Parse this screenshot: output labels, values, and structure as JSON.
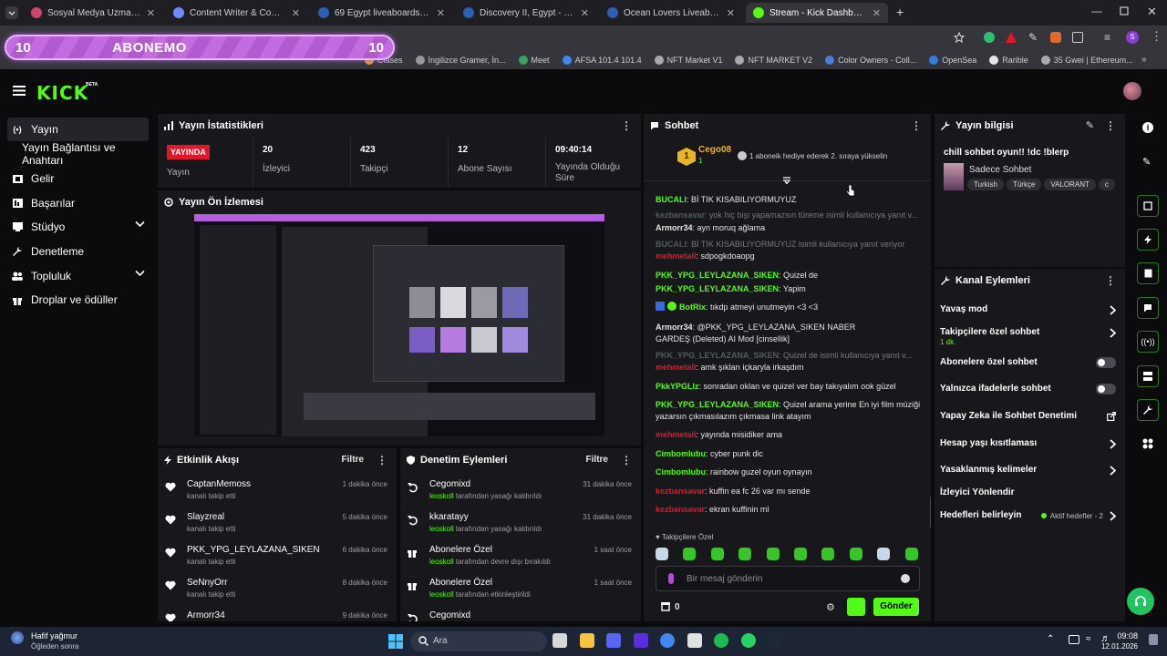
{
  "browser": {
    "tabs": [
      {
        "title": "Sosyal Medya Uzmanı Aranıyor",
        "color": "#d0446a"
      },
      {
        "title": "Content Writer & Community M...",
        "color": "#6b8cff"
      },
      {
        "title": "69 Egypt liveaboards, May 2026",
        "color": "#2b5fb3"
      },
      {
        "title": "Discovery II, Egypt - LiveAboa...",
        "color": "#2b5fb3"
      },
      {
        "title": "Ocean Lovers Liveaboard, Egypt",
        "color": "#2b5fb3"
      },
      {
        "title": "Stream - Kick Dashboard",
        "color": "#53fc18"
      }
    ],
    "new_tab": "+",
    "bookmarks": [
      "Clases",
      "İngilizce Gramer, İn...",
      "Meet",
      "AFSA 101.4 101.4",
      "NFT Market V1",
      "NFT MARKET V2",
      "Color Owners - Coll...",
      "OpenSea",
      "Rarible",
      "35 Gwei | Ethereum..."
    ]
  },
  "banner": {
    "left": "10",
    "title": "ABONEMO",
    "right": "10"
  },
  "kick": {
    "logo": "KICK",
    "beta": "BETA"
  },
  "sidebar": {
    "items": [
      {
        "label": "Yayın",
        "icon": "broadcast-icon"
      },
      {
        "label": "Yayın Bağlantısı ve Anahtarı",
        "icon": ""
      },
      {
        "label": "Gelir",
        "icon": "money-icon"
      },
      {
        "label": "Başarılar",
        "icon": "trophy-icon"
      },
      {
        "label": "Stüdyo",
        "icon": "studio-icon"
      },
      {
        "label": "Denetleme",
        "icon": "wrench-icon"
      },
      {
        "label": "Topluluk",
        "icon": "people-icon"
      },
      {
        "label": "Droplar ve ödüller",
        "icon": "gift-icon"
      }
    ]
  },
  "stats": {
    "title": "Yayın İstatistikleri",
    "live_badge": "YAYINDA",
    "items": [
      {
        "value": "",
        "label": "Yayın"
      },
      {
        "value": "20",
        "label": "İzleyici"
      },
      {
        "value": "423",
        "label": "Takipçi"
      },
      {
        "value": "12",
        "label": "Abone Sayısı"
      },
      {
        "value": "09:40:14",
        "label": "Yayında Olduğu Süre"
      }
    ]
  },
  "preview": {
    "title": "Yayın Ön İzlemesi"
  },
  "activity": {
    "title": "Etkinlik Akışı",
    "filter": "Filtre",
    "rows": [
      {
        "name": "CaptanMemoss",
        "sub": "kanalı takip etti",
        "time": "1 dakika önce"
      },
      {
        "name": "Slayzreal",
        "sub": "kanalı takip etti",
        "time": "5 dakika önce"
      },
      {
        "name": "PKK_YPG_LEYLAZANA_SIKEN",
        "sub": "kanalı takip etti",
        "time": "6 dakika önce"
      },
      {
        "name": "SeNnyOrr",
        "sub": "kanalı takip etti",
        "time": "8 dakika önce"
      },
      {
        "name": "Armorr34",
        "sub": "",
        "time": "9 dakika önce"
      }
    ]
  },
  "moderation": {
    "title": "Denetim Eylemleri",
    "filter": "Filtre",
    "rows": [
      {
        "name": "Cegomixd",
        "actor": "leoskoll",
        "sub": " tarafından yasağı kaldırıldı",
        "time": "31 dakika önce",
        "icon": "undo-icon"
      },
      {
        "name": "kkaratayy",
        "actor": "leoskoll",
        "sub": " tarafından yasağı kaldırıldı",
        "time": "31 dakika önce",
        "icon": "undo-icon"
      },
      {
        "name": "Abonelere Özel",
        "actor": "leoskoll",
        "sub": " tarafından devre dışı bırakıldı",
        "time": "1 saat önce",
        "icon": "gift-icon"
      },
      {
        "name": "Abonelere Özel",
        "actor": "leoskoll",
        "sub": " tarafından etkinleştirildi",
        "time": "1 saat önce",
        "icon": "gift-icon"
      },
      {
        "name": "Cegomixd",
        "actor": "",
        "sub": "",
        "time": "",
        "icon": "undo-icon"
      }
    ]
  },
  "chat": {
    "title": "Sohbet",
    "pinned_user": "Cego08",
    "pinned_rank": "1",
    "pinned_count": "1",
    "pinned_text": "1 aboneik hediye ederek 2. sıraya yükselin",
    "messages": [
      {
        "user": "BUCALI",
        "text": ": Bİ TIK KISABILIYORMUYUZ",
        "color": "#53fc18",
        "dim": false
      },
      {
        "user": "kezbansavar",
        "text": ": yok hiç bişi yapamazsın türeme isimli kullanıcıya yanıt v...",
        "color": "#9aa",
        "dim": true
      },
      {
        "user": "Armorr34",
        "text": ": ayn moruq ağlama",
        "color": "#e6e6e6",
        "dim": false
      },
      {
        "user": "BUCALI",
        "text": ": Bİ TIK KISABILIYORMUYUZ isimli kullanıcıya yanıt veriyor",
        "color": "#9aa",
        "dim": true
      },
      {
        "user": "mehmetali",
        "text": ": sdpogkdoaopg",
        "color": "#e0162b",
        "dim": false
      },
      {
        "user": "PKK_YPG_LEYLAZANA_SIKEN",
        "text": ": Quizel de",
        "color": "#53fc18",
        "dim": false
      },
      {
        "user": "PKK_YPG_LEYLAZANA_SIKEN",
        "text": ": Yapim",
        "color": "#53fc18",
        "dim": false
      },
      {
        "user": "BotRix",
        "text": ": tıkdp atmeyi unutmeyin <3 <3",
        "color": "#53fc18",
        "dim": false
      },
      {
        "user": "Armorr34",
        "text": ": @PKK_YPG_LEYLAZANA_SIKEN NABER",
        "color": "#e6e6e6",
        "dim": false
      },
      {
        "user": "",
        "text": "GARDEŞ (Deleted) AI Mod [cinsellik]",
        "color": "#e6e6e6",
        "dim": false
      },
      {
        "user": "PKK_YPG_LEYLAZANA_SIKEN",
        "text": ": Quizel de isimli kullanıcıya yanıt v...",
        "color": "#9aa",
        "dim": true
      },
      {
        "user": "mehmetali",
        "text": ": amk şıkları içkaryla irkaşdım",
        "color": "#e0162b",
        "dim": false
      },
      {
        "user": "PkkYPGLlz",
        "text": ": sonradan oklan ve quizel ver bay takıyalım ook güzel",
        "color": "#53fc18",
        "dim": false
      },
      {
        "user": "PKK_YPG_LEYLAZANA_SIKEN",
        "text": ": Quizel arama yerine En iyi film müziği",
        "color": "#53fc18",
        "dim": false
      },
      {
        "user": "",
        "text": "yazarsın çıkmasılazım çıkmasa link atayım",
        "color": "#e6e6e6",
        "dim": false
      },
      {
        "user": "mehmetali",
        "text": ": yayında misidiker ama",
        "color": "#e0162b",
        "dim": false
      },
      {
        "user": "Cimbomlubu",
        "text": ": cyber punk dic",
        "color": "#53fc18",
        "dim": false
      },
      {
        "user": "Cimbomlubu",
        "text": ": rainbow guzel oyun oynayın",
        "color": "#53fc18",
        "dim": false
      },
      {
        "user": "kezbansavar",
        "text": ": kuffin ea fc 26 var mı sende",
        "color": "#e0162b",
        "dim": false
      },
      {
        "user": "kezbansavar",
        "text": ": ekran kuffinin ml",
        "color": "#e0162b",
        "dim": false
      }
    ],
    "followers_only": "Takipçilere Özel",
    "input_placeholder": "Bir mesaj gönderin",
    "points": "0",
    "send": "Gönder"
  },
  "stream_info": {
    "title": "Yayın bilgisi",
    "stream_title": "chill sohbet oyun!! !dc !blerp",
    "category": "Sadece Sohbet",
    "tags": [
      "Turkish",
      "Türkçe",
      "VALORANT",
      "c"
    ]
  },
  "channel_actions": {
    "title": "Kanal Eylemleri",
    "items": [
      {
        "label": "Yavaş mod",
        "sub": "",
        "type": "chevron"
      },
      {
        "label": "Takipçilere özel sohbet",
        "sub": "1 dk.",
        "type": "chevron"
      },
      {
        "label": "Abonelere özel sohbet",
        "sub": "",
        "type": "toggle"
      },
      {
        "label": "Yalnızca ifadelerle sohbet",
        "sub": "",
        "type": "toggle"
      },
      {
        "label": "Yapay Zeka ile Sohbet Denetimi",
        "sub": "",
        "type": "external"
      },
      {
        "label": "Hesap yaşı kısıtlaması",
        "sub": "",
        "type": "chevron"
      },
      {
        "label": "Yasaklanmış kelimeler",
        "sub": "",
        "type": "chevron"
      },
      {
        "label": "İzleyici Yönlendir",
        "sub": "",
        "type": "none"
      },
      {
        "label": "Hedefleri belirleyin",
        "sub": "Aktif hedefler - 2",
        "type": "chevron"
      }
    ]
  },
  "taskbar": {
    "weather": "Hafif yağmur",
    "weather_sub": "Öğleden sonra",
    "search": "Ara",
    "time": "09:08",
    "date": "12.01.2026"
  },
  "colors": {
    "kick_green": "#53fc18",
    "live_red": "#e0162b",
    "panel": "#18181c"
  }
}
